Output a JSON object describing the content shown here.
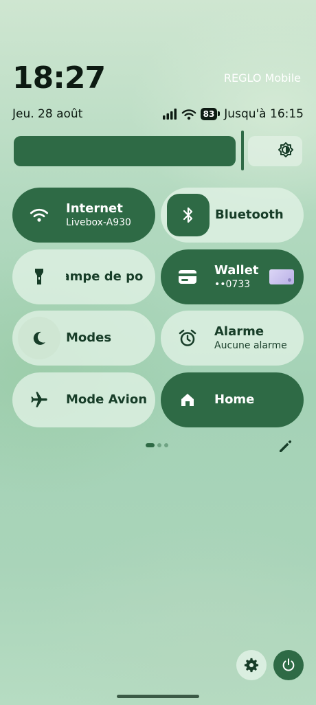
{
  "header": {
    "time": "18:27",
    "carrier": "REGLO Mobile",
    "date": "Jeu. 28 août",
    "battery_level": "83",
    "battery_text": "Jusqu'à 16:15"
  },
  "brightness": {
    "level": 0.8
  },
  "tiles": {
    "internet": {
      "label": "Internet",
      "sub": "Livebox-A930",
      "icon": "wifi-icon"
    },
    "bluetooth": {
      "label": "Bluetooth",
      "icon": "bluetooth-icon"
    },
    "flashlight": {
      "label": "Lampe de poche",
      "icon": "flashlight-icon"
    },
    "wallet": {
      "label": "Wallet",
      "sub": "••0733",
      "icon": "wallet-icon"
    },
    "modes": {
      "label": "Modes",
      "icon": "moon-icon"
    },
    "alarm": {
      "label": "Alarme",
      "sub": "Aucune alarme",
      "icon": "alarm-icon"
    },
    "airplane": {
      "label": "Mode Avion",
      "icon": "airplane-icon"
    },
    "home": {
      "label": "Home",
      "icon": "home-icon"
    }
  },
  "pager": {
    "pages": 3,
    "current": 1
  },
  "colors": {
    "tile_active": "#2e6a45",
    "tile_inactive": "#e1f2e5",
    "text_on_active": "#ffffff",
    "text_on_inactive": "#173d28"
  }
}
